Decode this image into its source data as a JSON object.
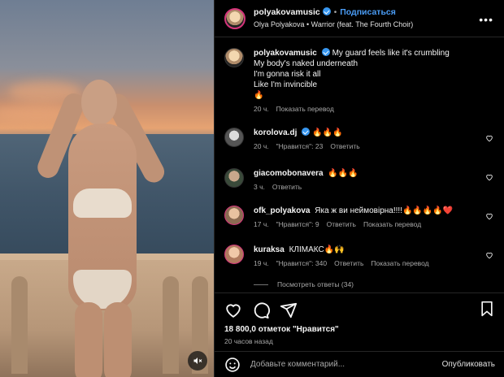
{
  "post": {
    "author": "polyakovamusic",
    "follow_label": "Подписаться",
    "audio": "Olya Polyakova • Warrior (feat. The Fourth Choir)",
    "caption_user": "polyakovamusic",
    "caption_lines": [
      "My guard feels like it's crumbling",
      "My body's naked underneath",
      "I'm gonna risk it all",
      "Like I'm invincible",
      "🔥"
    ],
    "caption_time": "20 ч.",
    "caption_translate": "Показать перевод"
  },
  "comments": [
    {
      "user": "korolova.dj",
      "text": "🔥🔥🔥",
      "time": "20 ч.",
      "likes": "\"Нравится\": 23",
      "reply": "Ответить",
      "translate": ""
    },
    {
      "user": "giacomobonavera",
      "text": "🔥🔥🔥",
      "time": "3 ч.",
      "likes": "",
      "reply": "Ответить",
      "translate": ""
    },
    {
      "user": "ofk_polyakova",
      "text": "Яка ж ви неймовірна!!!!🔥🔥🔥🔥❤️",
      "time": "17 ч.",
      "likes": "\"Нравится\": 9",
      "reply": "Ответить",
      "translate": "Показать перевод"
    },
    {
      "user": "kuraksa",
      "text": "КЛІМАКС🔥🙌",
      "time": "19 ч.",
      "likes": "\"Нравится\": 340",
      "reply": "Ответить",
      "translate": "Показать перевод"
    }
  ],
  "view_replies": "Посмотреть ответы (34)",
  "stats": {
    "likes": "18 800,0 отметок \"Нравится\"",
    "ago": "20 часов назад"
  },
  "composer": {
    "placeholder": "Добавьте комментарий...",
    "post_label": "Опубликовать"
  },
  "colors": {
    "accent": "#4a9cf5",
    "verified": "#3897f0",
    "background": "#000000"
  }
}
